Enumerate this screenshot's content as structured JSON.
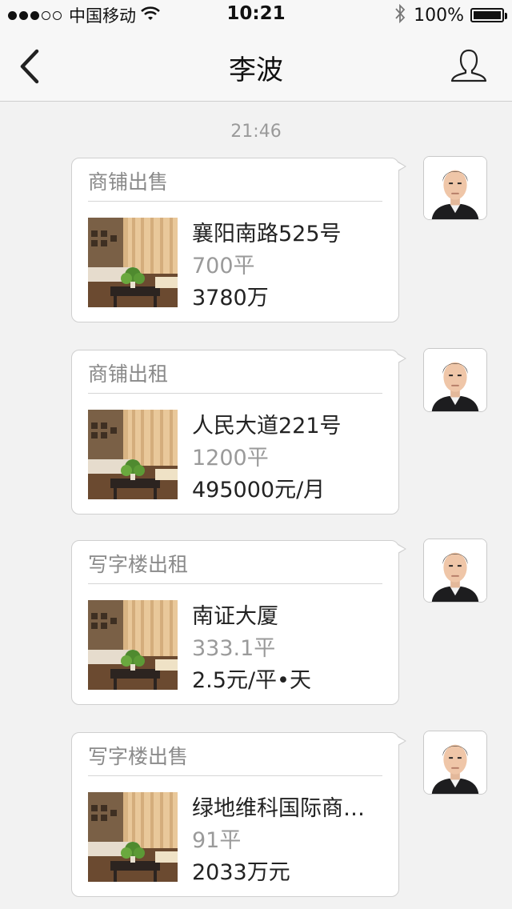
{
  "status_bar": {
    "carrier": "中国移动",
    "time": "10:21",
    "battery": "100%"
  },
  "nav": {
    "title": "李波",
    "back_icon": "chevron-left-icon",
    "profile_icon": "user-icon"
  },
  "timestamp": "21:46",
  "messages": [
    {
      "category": "商铺出售",
      "address": "襄阳南路525号",
      "area": "700平",
      "price": "3780万"
    },
    {
      "category": "商铺出租",
      "address": "人民大道221号",
      "area": "1200平",
      "price": "495000元/月"
    },
    {
      "category": "写字楼出租",
      "address": "南证大厦",
      "area": "333.1平",
      "price": "2.5元/平•天"
    },
    {
      "category": "写字楼出售",
      "address": "绿地维科国际商…",
      "area": "91平",
      "price": "2033万元"
    }
  ],
  "colors": {
    "background": "#f2f2f2",
    "bubble": "#ffffff",
    "muted_text": "#9a9a9a"
  }
}
